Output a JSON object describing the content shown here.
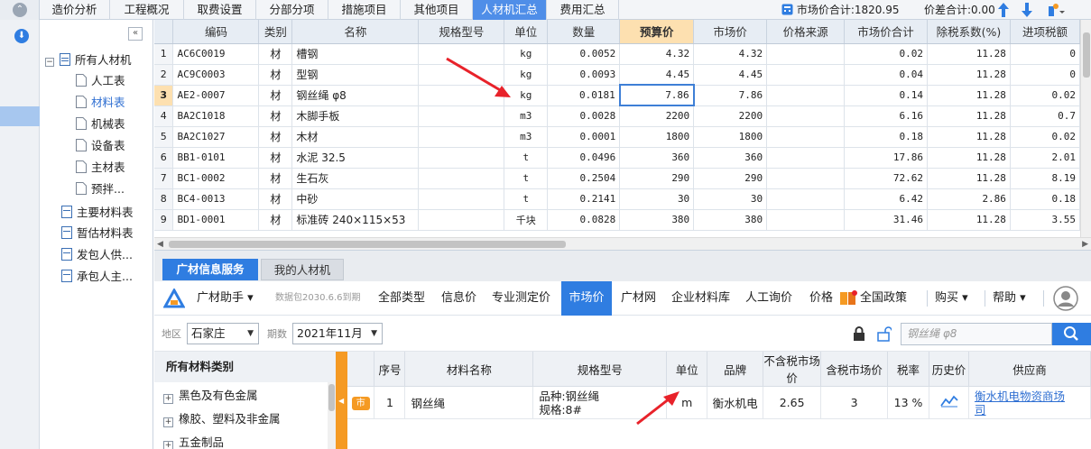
{
  "top_tabs": [
    "造价分析",
    "工程概况",
    "取费设置",
    "分部分项",
    "措施项目",
    "其他项目",
    "人材机汇总",
    "费用汇总"
  ],
  "active_top_tab": "人材机汇总",
  "summary": {
    "market_total": "市场价合计:1820.95",
    "diff_total": "价差合计:0.00"
  },
  "tree": {
    "root": "所有人材机",
    "children": [
      "人工表",
      "材料表",
      "机械表",
      "设备表",
      "主材表",
      "预拌..."
    ],
    "selected": "材料表",
    "others": [
      "主要材料表",
      "暂估材料表",
      "发包人供...",
      "承包人主..."
    ]
  },
  "grid": {
    "columns": [
      "编码",
      "类别",
      "名称",
      "规格型号",
      "单位",
      "数量",
      "预算价",
      "市场价",
      "价格来源",
      "市场价合计",
      "除税系数(%)",
      "进项税额"
    ],
    "highlight_column": "预算价",
    "rows": [
      {
        "no": "1",
        "code": "AC6C0019",
        "cat": "材",
        "name": "槽钢",
        "spec": "",
        "unit": "kg",
        "qty": "0.0052",
        "budget": "4.32",
        "market": "4.32",
        "source": "",
        "total": "0.02",
        "coef": "11.28",
        "tax": "0"
      },
      {
        "no": "2",
        "code": "AC9C0003",
        "cat": "材",
        "name": "型钢",
        "spec": "",
        "unit": "kg",
        "qty": "0.0093",
        "budget": "4.45",
        "market": "4.45",
        "source": "",
        "total": "0.04",
        "coef": "11.28",
        "tax": "0"
      },
      {
        "no": "3",
        "code": "AE2-0007",
        "cat": "材",
        "name": "钢丝绳 φ8",
        "spec": "",
        "unit": "kg",
        "qty": "0.0181",
        "budget": "7.86",
        "market": "7.86",
        "source": "",
        "total": "0.14",
        "coef": "11.28",
        "tax": "0.02"
      },
      {
        "no": "4",
        "code": "BA2C1018",
        "cat": "材",
        "name": "木脚手板",
        "spec": "",
        "unit": "m3",
        "qty": "0.0028",
        "budget": "2200",
        "market": "2200",
        "source": "",
        "total": "6.16",
        "coef": "11.28",
        "tax": "0.7"
      },
      {
        "no": "5",
        "code": "BA2C1027",
        "cat": "材",
        "name": "木材",
        "spec": "",
        "unit": "m3",
        "qty": "0.0001",
        "budget": "1800",
        "market": "1800",
        "source": "",
        "total": "0.18",
        "coef": "11.28",
        "tax": "0.02"
      },
      {
        "no": "6",
        "code": "BB1-0101",
        "cat": "材",
        "name": "水泥 32.5",
        "spec": "",
        "unit": "t",
        "qty": "0.0496",
        "budget": "360",
        "market": "360",
        "source": "",
        "total": "17.86",
        "coef": "11.28",
        "tax": "2.01"
      },
      {
        "no": "7",
        "code": "BC1-0002",
        "cat": "材",
        "name": "生石灰",
        "spec": "",
        "unit": "t",
        "qty": "0.2504",
        "budget": "290",
        "market": "290",
        "source": "",
        "total": "72.62",
        "coef": "11.28",
        "tax": "8.19"
      },
      {
        "no": "8",
        "code": "BC4-0013",
        "cat": "材",
        "name": "中砂",
        "spec": "",
        "unit": "t",
        "qty": "0.2141",
        "budget": "30",
        "market": "30",
        "source": "",
        "total": "6.42",
        "coef": "2.86",
        "tax": "0.18"
      },
      {
        "no": "9",
        "code": "BD1-0001",
        "cat": "材",
        "name": "标准砖 240×115×53",
        "spec": "",
        "unit": "千块",
        "qty": "0.0828",
        "budget": "380",
        "market": "380",
        "source": "",
        "total": "31.46",
        "coef": "11.28",
        "tax": "3.55"
      }
    ],
    "selected_row": "3"
  },
  "bottom_tabs": [
    "广材信息服务",
    "我的人材机"
  ],
  "toolbar": {
    "assistant": "广材助手",
    "version": "数据包2030.6.6到期",
    "items": [
      "全部类型",
      "信息价",
      "专业测定价",
      "市场价",
      "广材网",
      "企业材料库",
      "人工询价",
      "价格",
      "全国政策",
      "购买",
      "帮助"
    ],
    "active": "市场价"
  },
  "filter": {
    "region_label": "地区",
    "region": "石家庄",
    "period_label": "期数",
    "period": "2021年11月",
    "search_placeholder": "钢丝绳 φ8"
  },
  "categories": {
    "header": "所有材料类别",
    "items": [
      "黑色及有色金属",
      "橡胶、塑料及非金属",
      "五金制品"
    ]
  },
  "result": {
    "columns": [
      "序号",
      "材料名称",
      "规格型号",
      "单位",
      "品牌",
      "不含税市场价",
      "含税市场价",
      "税率",
      "历史价",
      "供应商"
    ],
    "rows": [
      {
        "tag": "市",
        "no": "1",
        "name": "钢丝绳",
        "spec1": "品种:钢丝绳",
        "spec2": "规格:8#",
        "unit": "m",
        "brand": "衡水机电",
        "price_ex": "2.65",
        "price_in": "3",
        "rate": "13 %",
        "supplier1": "衡水机电物资商场",
        "supplier2": "司"
      }
    ]
  },
  "colors": {
    "accent": "#2f7de1",
    "highlight": "#fde0b0",
    "arrow": "#e8222a"
  }
}
